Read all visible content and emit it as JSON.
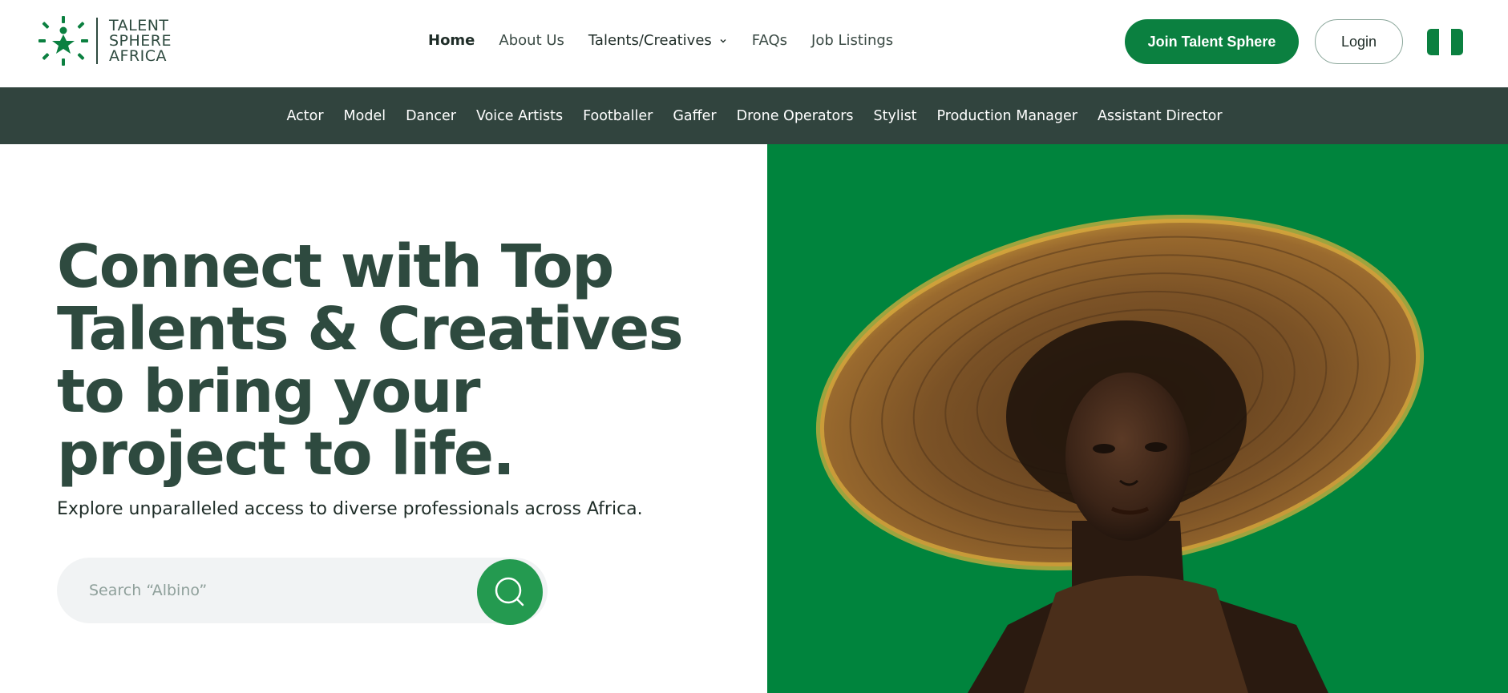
{
  "brand": {
    "line1": "TALENT",
    "line2": "SPHERE",
    "line3": "AFRICA",
    "color": "#0b8040"
  },
  "nav": {
    "items": [
      {
        "label": "Home",
        "active": true
      },
      {
        "label": "About Us"
      },
      {
        "label": "Talents/Creatives",
        "dropdown": true
      },
      {
        "label": "FAQs"
      },
      {
        "label": "Job Listings"
      }
    ]
  },
  "actions": {
    "join_label": "Join Talent Sphere",
    "login_label": "Login",
    "flag_icon": "nigeria-flag-icon"
  },
  "categories": [
    "Actor",
    "Model",
    "Dancer",
    "Voice Artists",
    "Footballer",
    "Gaffer",
    "Drone Operators",
    "Stylist",
    "Production Manager",
    "Assistant Director"
  ],
  "hero": {
    "headline": "Connect with Top Talents & Creatives to bring your project to life.",
    "subline": "Explore unparalleled access to diverse professionals across Africa.",
    "search_placeholder": "Search “Albino”"
  },
  "colors": {
    "primary_green": "#0b8040",
    "hero_green": "#00843d",
    "dark_bar": "#31443e",
    "heading": "#2e4a3f"
  }
}
